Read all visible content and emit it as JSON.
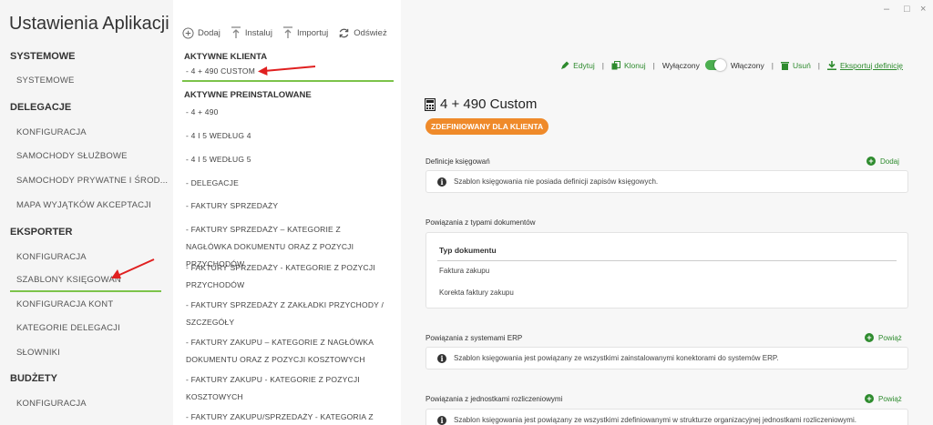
{
  "app_title": "Ustawienia Aplikacji",
  "sidebar": {
    "sections": [
      {
        "title": "SYSTEMOWE",
        "items": [
          "SYSTEMOWE"
        ]
      },
      {
        "title": "DELEGACJE",
        "items": [
          "KONFIGURACJA",
          "SAMOCHODY SŁUŻBOWE",
          "SAMOCHODY PRYWATNE I ŚROD...",
          "MAPA WYJĄTKÓW AKCEPTACJI"
        ]
      },
      {
        "title": "EKSPORTER",
        "items": [
          "KONFIGURACJA",
          "SZABLONY KSIĘGOWAŃ",
          "KONFIGURACJA KONT",
          "KATEGORIE DELEGACJI",
          "SŁOWNIKI"
        ]
      },
      {
        "title": "BUDŻETY",
        "items": [
          "KONFIGURACJA"
        ]
      }
    ],
    "active_item": "SZABLONY KSIĘGOWAŃ"
  },
  "toolbar": {
    "add": "Dodaj",
    "install": "Instaluj",
    "import": "Importuj",
    "refresh": "Odśwież"
  },
  "templates": {
    "client_title": "AKTYWNE KLIENTA",
    "client_items": [
      "- 4 + 490 CUSTOM"
    ],
    "preinstalled_title": "AKTYWNE PREINSTALOWANE",
    "preinstalled_items": [
      "- 4 + 490",
      "- 4 I 5 WEDŁUG 4",
      "- 4 I 5 WEDŁUG 5",
      "- DELEGACJE",
      "- FAKTURY SPRZEDAŻY",
      "- FAKTURY SPRZEDAŻY – KATEGORIE Z NAGŁÓWKA DOKUMENTU ORAZ Z POZYCJI PRZYCHODÓW",
      "- FAKTURY SPRZEDAŻY - KATEGORIE Z POZYCJI PRZYCHODÓW",
      "- FAKTURY SPRZEDAŻY Z ZAKŁADKI PRZYCHODY / SZCZEGÓŁY",
      "- FAKTURY ZAKUPU – KATEGORIE Z NAGŁÓWKA DOKUMENTU ORAZ Z POZYCJI KOSZTOWYCH",
      "- FAKTURY ZAKUPU - KATEGORIE Z POZYCJI KOSZTOWYCH",
      "- FAKTURY ZAKUPU/SPRZEDAŻY - KATEGORIA Z"
    ]
  },
  "actions": {
    "edit": "Edytuj",
    "clone": "Klonuj",
    "off": "Wyłączony",
    "on": "Włączony",
    "delete": "Usuń",
    "export": "Eksportuj definicję",
    "separator": "|",
    "toggle_enabled": true
  },
  "detail": {
    "title": "4 + 490 Custom",
    "badge": "ZDEFINIOWANY DLA KLIENTA",
    "definitions_label": "Definicje księgowań",
    "definitions_action": "Dodaj",
    "definitions_info": "Szablon księgowania nie posiada definicji zapisów księgowych.",
    "doc_types_label": "Powiązania z typami dokumentów",
    "doc_types_header": "Typ dokumentu",
    "doc_types_rows": [
      "Faktura zakupu",
      "Korekta faktury zakupu"
    ],
    "erp_label": "Powiązania z systemami ERP",
    "erp_action": "Powiąż",
    "erp_info": "Szablon księgowania jest powiązany ze wszystkimi zainstalowanymi konektorami do systemów ERP.",
    "units_label": "Powiązania z jednostkami rozliczeniowymi",
    "units_action": "Powiąż",
    "units_info": "Szablon księgowania jest powiązany ze wszystkimi zdefiniowanymi w strukturze organizacyjnej jednostkami rozliczeniowymi."
  },
  "window_controls": {
    "minimize": "–",
    "maximize": "□",
    "close": "×"
  },
  "colors": {
    "accent_green": "#7cc34a",
    "action_green": "#2e8b2e",
    "badge_orange": "#ef8a2a",
    "annotation_red": "#e02020"
  }
}
